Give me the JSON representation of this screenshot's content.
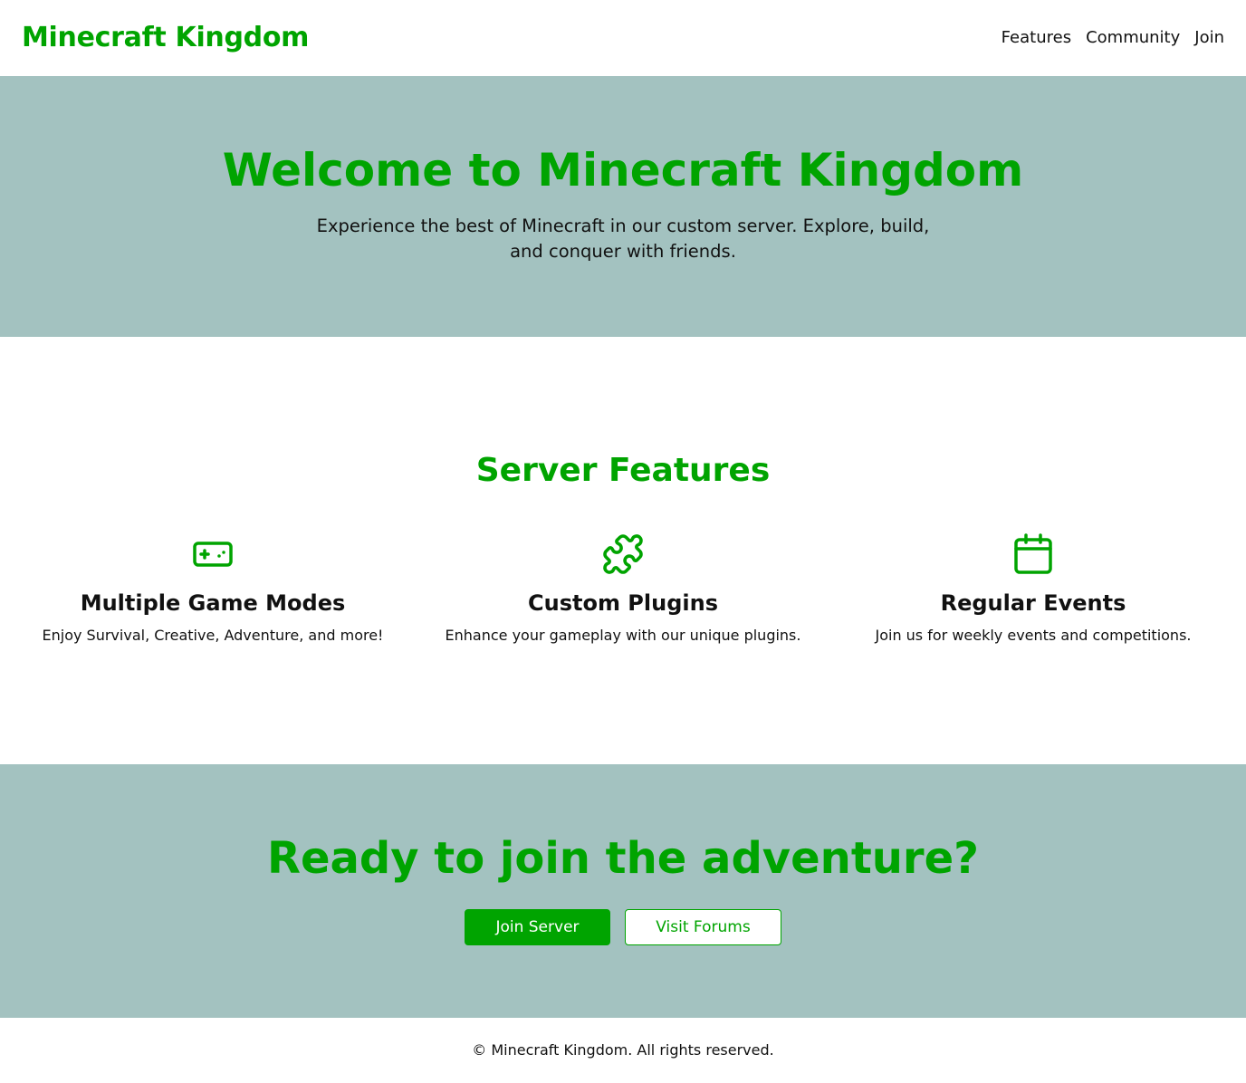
{
  "header": {
    "brand": "Minecraft Kingdom",
    "nav": [
      "Features",
      "Community",
      "Join"
    ]
  },
  "hero": {
    "title": "Welcome to Minecraft Kingdom",
    "subtitle": "Experience the best of Minecraft in our custom server. Explore, build, and conquer with friends."
  },
  "features": {
    "title": "Server Features",
    "items": [
      {
        "icon": "gamepad-icon",
        "title": "Multiple Game Modes",
        "description": "Enjoy Survival, Creative, Adventure, and more!"
      },
      {
        "icon": "puzzle-icon",
        "title": "Custom Plugins",
        "description": "Enhance your gameplay with our unique plugins."
      },
      {
        "icon": "calendar-icon",
        "title": "Regular Events",
        "description": "Join us for weekly events and competitions."
      }
    ]
  },
  "cta": {
    "title": "Ready to join the adventure?",
    "primary_label": "Join Server",
    "secondary_label": "Visit Forums"
  },
  "footer": {
    "text": "© Minecraft Kingdom. All rights reserved."
  },
  "colors": {
    "accent": "#00a400",
    "section_bg": "#a3c2c0",
    "text": "#111111"
  }
}
